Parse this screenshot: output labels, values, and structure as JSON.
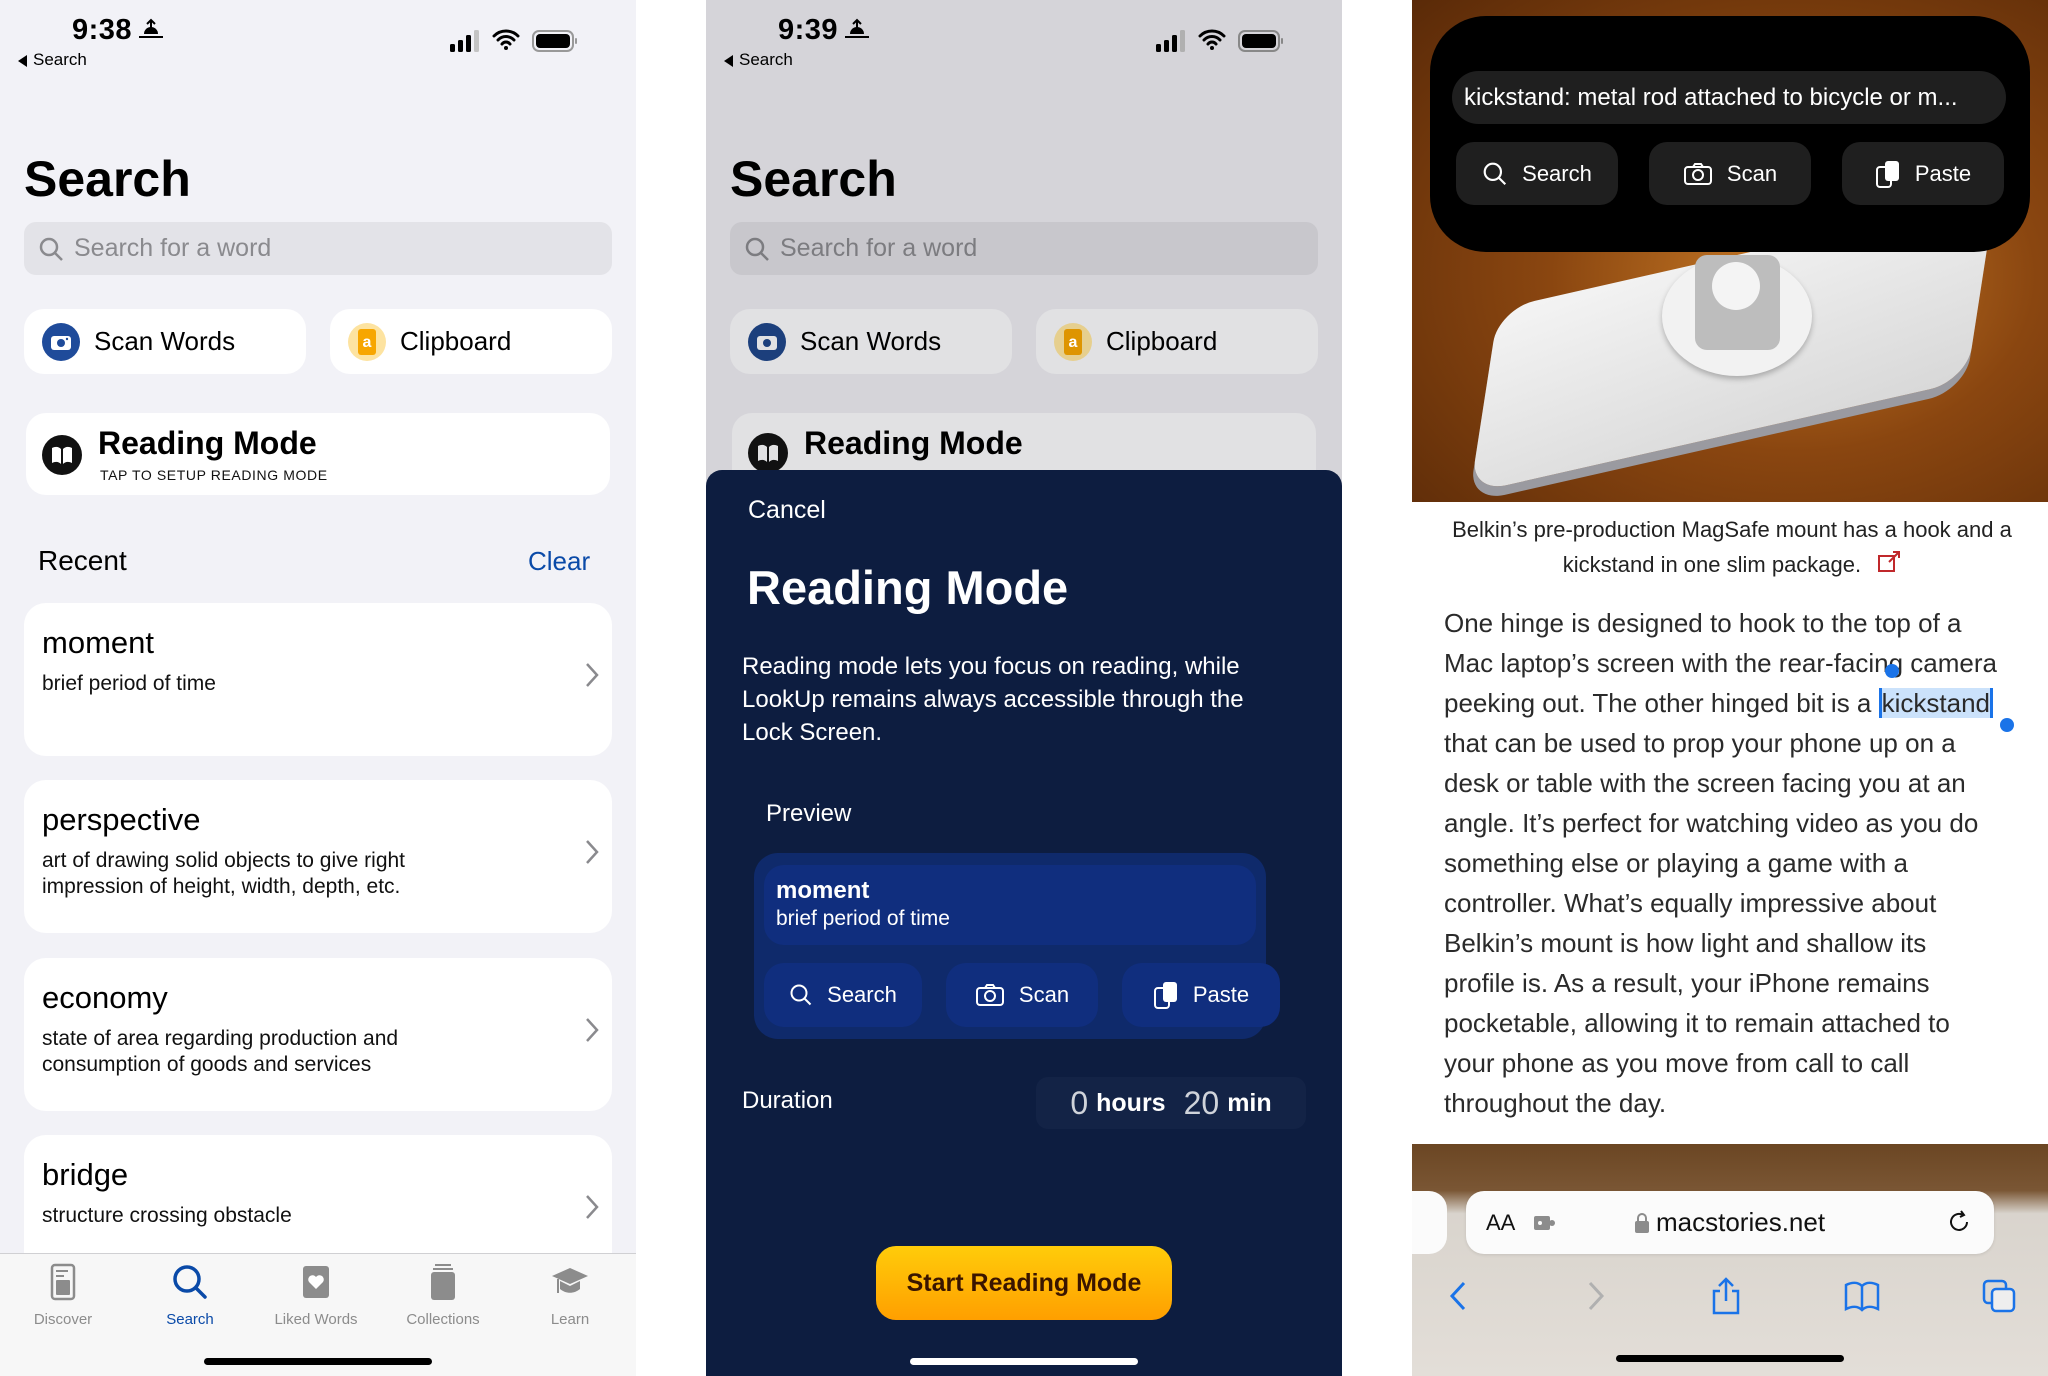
{
  "screens": [
    {
      "status": {
        "time": "9:38",
        "back_label": "Search"
      },
      "title": "Search",
      "search": {
        "placeholder": "Search for a word"
      },
      "quick_actions": [
        {
          "label": "Scan Words",
          "icon": "camera-icon"
        },
        {
          "label": "Clipboard",
          "icon": "clipboard-icon"
        }
      ],
      "reading_mode": {
        "title": "Reading Mode",
        "subtitle": "TAP TO SETUP READING MODE"
      },
      "recent": {
        "heading": "Recent",
        "clear_label": "Clear",
        "items": [
          {
            "word": "moment",
            "definition": "brief period of time"
          },
          {
            "word": "perspective",
            "definition": "art of drawing solid objects to give right impression of height, width, depth, etc."
          },
          {
            "word": "economy",
            "definition": "state of area regarding production and consumption of goods and services"
          },
          {
            "word": "bridge",
            "definition": "structure crossing obstacle"
          }
        ]
      },
      "tabs": [
        {
          "label": "Discover",
          "icon": "document-icon",
          "active": false
        },
        {
          "label": "Search",
          "icon": "search-icon",
          "active": true
        },
        {
          "label": "Liked Words",
          "icon": "heart-icon",
          "active": false
        },
        {
          "label": "Collections",
          "icon": "stack-icon",
          "active": false
        },
        {
          "label": "Learn",
          "icon": "graduation-cap-icon",
          "active": false
        }
      ],
      "accent": "#0a4aa8"
    },
    {
      "status": {
        "time": "9:39",
        "back_label": "Search"
      },
      "title": "Search",
      "search": {
        "placeholder": "Search for a word"
      },
      "quick_actions": [
        {
          "label": "Scan Words",
          "icon": "camera-icon"
        },
        {
          "label": "Clipboard",
          "icon": "clipboard-icon"
        }
      ],
      "reading_mode_card_title": "Reading Mode",
      "sheet": {
        "cancel_label": "Cancel",
        "title": "Reading Mode",
        "description": "Reading mode lets you focus on reading, while LookUp remains always accessible through the Lock Screen.",
        "preview_label": "Preview",
        "preview": {
          "word": "moment",
          "definition": "brief period of time",
          "buttons": [
            "Search",
            "Scan",
            "Paste"
          ]
        },
        "duration_label": "Duration",
        "duration": {
          "hours": "0",
          "hours_unit": "hours",
          "minutes": "20",
          "minutes_unit": "min"
        },
        "start_label": "Start Reading Mode",
        "bg_color": "#0d1d40",
        "button_color": "#ffb300"
      }
    },
    {
      "overlay": {
        "definition": "kickstand: metal rod attached to bicycle or m...",
        "buttons": [
          "Search",
          "Scan",
          "Paste"
        ]
      },
      "caption": "Belkin’s pre-production MagSafe mount has a hook and a kickstand in one slim package.",
      "article_lines": [
        "One hinge is designed to hook to the top of a",
        "Mac laptop’s screen with the rear-facing camera",
        "peeking out. The other hinged bit is a ",
        "that can be used to prop your phone up on a",
        "desk or table with the screen facing you at an",
        "angle. It’s perfect for watching video as you do",
        "something else or playing a game with a",
        "controller. What’s equally impressive about",
        "Belkin’s mount is how light and shallow its",
        "profile is. As a result, your iPhone remains",
        "pocketable, allowing it to remain attached to",
        "your phone as you move from call to call",
        "throughout the day."
      ],
      "selected_word": "kickstand",
      "browser": {
        "text_size_label": "AA",
        "url": "macstories.net"
      },
      "selection_color": "#1a73e8"
    }
  ]
}
